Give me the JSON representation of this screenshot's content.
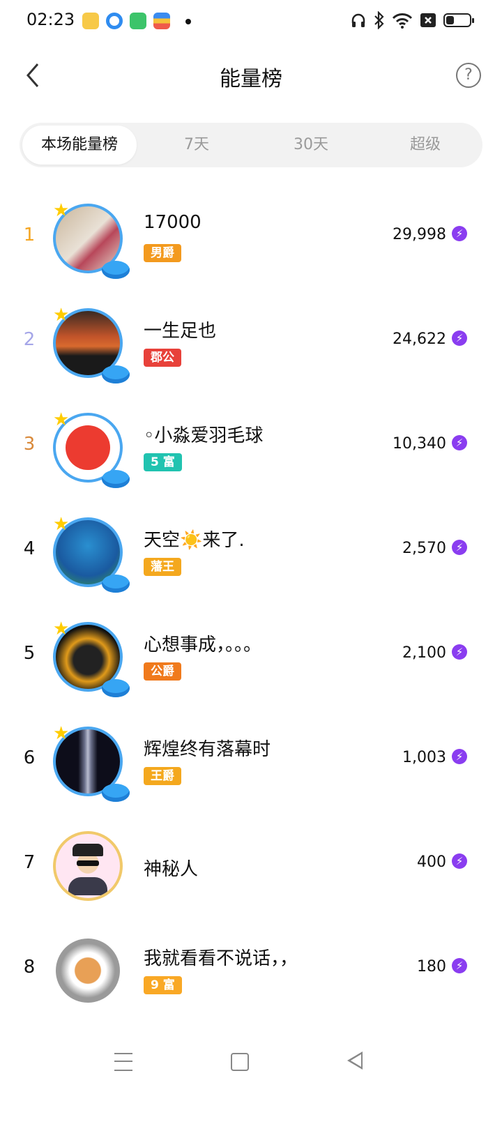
{
  "status_bar": {
    "time": "02:23",
    "icons": [
      "book-app-icon",
      "circle-app-icon",
      "shop-app-icon",
      "wallet-app-icon",
      "headphone-icon",
      "bluetooth-icon",
      "wifi-icon",
      "sim-x-icon",
      "battery-icon"
    ],
    "battery_level": 0.35
  },
  "header": {
    "title": "能量榜",
    "help_glyph": "?"
  },
  "tabs": [
    {
      "label": "本场能量榜",
      "active": true
    },
    {
      "label": "7天"
    },
    {
      "label": "30天"
    },
    {
      "label": "超级"
    }
  ],
  "leaderboard": [
    {
      "rank": "1",
      "name": "17000",
      "badge": "男爵",
      "score": "29,998",
      "rank_color": "#f5a623",
      "badge_color": "#f39a1e"
    },
    {
      "rank": "2",
      "name": "一生足也",
      "badge": "郡公",
      "score": "24,622",
      "rank_color": "#a5a6e8",
      "badge_color": "#e8413a"
    },
    {
      "rank": "3",
      "name": "◦小淼爱羽毛球",
      "badge": "5 富",
      "score": "10,340",
      "rank_color": "#d9893a",
      "badge_color": "#21c3b0"
    },
    {
      "rank": "4",
      "name": "天空☀️来了.",
      "badge": "藩王",
      "score": "2,570",
      "rank_color": "#111111",
      "badge_color": "#f4a81e"
    },
    {
      "rank": "5",
      "name": "心想事成，。。。",
      "badge": "公爵",
      "score": "2,100",
      "rank_color": "#111111",
      "badge_color": "#f07a1c"
    },
    {
      "rank": "6",
      "name": "辉煌终有落幕时",
      "badge": "王爵",
      "score": "1,003",
      "rank_color": "#111111",
      "badge_color": "#f4a81e"
    },
    {
      "rank": "7",
      "name": "神秘人",
      "badge": "",
      "score": "400",
      "rank_color": "#111111",
      "badge_color": ""
    },
    {
      "rank": "8",
      "name": "我就看看不说话，，",
      "badge": "9 富",
      "score": "180",
      "rank_color": "#111111",
      "badge_color": "#f9a825"
    }
  ],
  "energy_icon": "lightning-energy-icon",
  "nav": {
    "menu_icon": "menu-icon",
    "home_icon": "home-square-icon",
    "back_icon": "back-triangle-icon"
  }
}
